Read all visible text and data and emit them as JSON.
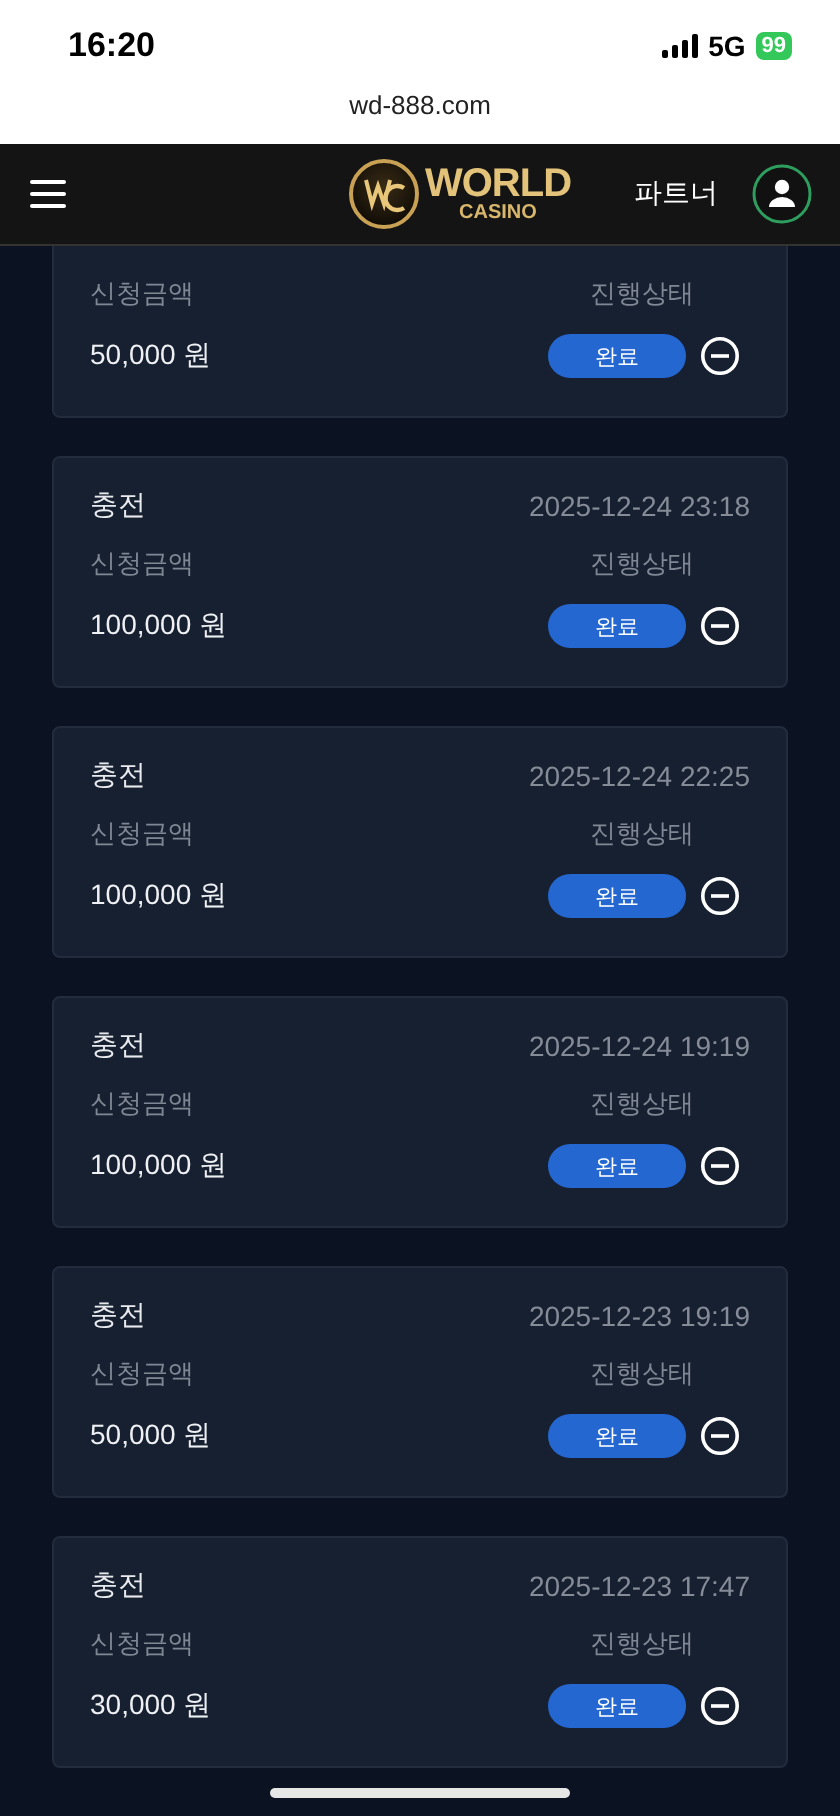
{
  "status_bar": {
    "time": "16:20",
    "network": "5G",
    "battery": "99"
  },
  "browser": {
    "url": "wd-888.com"
  },
  "header": {
    "logo_word": "WORLD",
    "logo_sub": "CASINO",
    "partner_link": "파트너"
  },
  "records": [
    {
      "amount_label": "신청금액",
      "amount": "50,000 원",
      "status_label": "진행상태",
      "status": "완료"
    },
    {
      "type": "충전",
      "datetime": "2025-12-24 23:18",
      "amount_label": "신청금액",
      "amount": "100,000 원",
      "status_label": "진행상태",
      "status": "완료"
    },
    {
      "type": "충전",
      "datetime": "2025-12-24 22:25",
      "amount_label": "신청금액",
      "amount": "100,000 원",
      "status_label": "진행상태",
      "status": "완료"
    },
    {
      "type": "충전",
      "datetime": "2025-12-24 19:19",
      "amount_label": "신청금액",
      "amount": "100,000 원",
      "status_label": "진행상태",
      "status": "완료"
    },
    {
      "type": "충전",
      "datetime": "2025-12-23 19:19",
      "amount_label": "신청금액",
      "amount": "50,000 원",
      "status_label": "진행상태",
      "status": "완료"
    },
    {
      "type": "충전",
      "datetime": "2025-12-23 17:47",
      "amount_label": "신청금액",
      "amount": "30,000 원",
      "status_label": "진행상태",
      "status": "완료"
    }
  ]
}
